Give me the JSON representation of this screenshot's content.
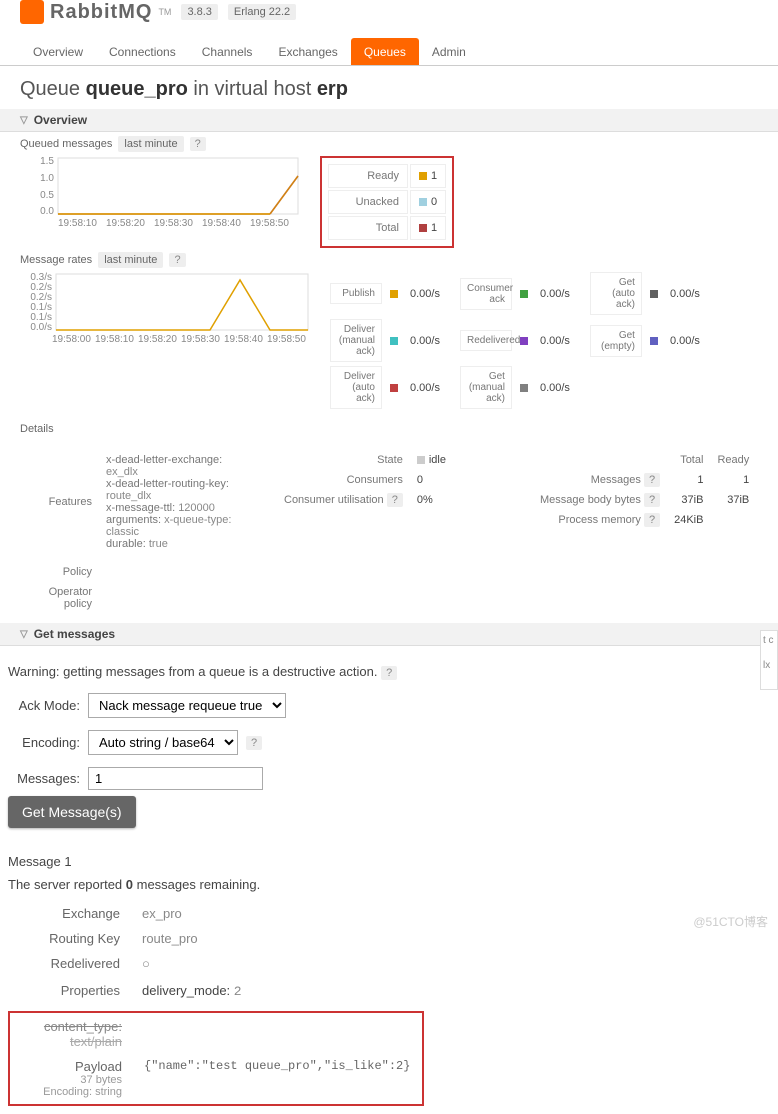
{
  "header": {
    "logo_text": "RabbitMQ",
    "tm": "TM",
    "version": "3.8.3",
    "erlang": "Erlang 22.2"
  },
  "tabs": [
    "Overview",
    "Connections",
    "Channels",
    "Exchanges",
    "Queues",
    "Admin"
  ],
  "active_tab": 4,
  "page_title_prefix": "Queue ",
  "queue_name": "queue_pro",
  "page_title_mid": " in virtual host ",
  "vhost": "erp",
  "overview_label": "Overview",
  "queued_msg_label": "Queued messages",
  "last_minute": "last minute",
  "help_q": "?",
  "queued_chart": {
    "y_ticks": [
      "1.5",
      "1.0",
      "0.5",
      "0.0"
    ],
    "x_ticks": [
      "19:58:10",
      "19:58:20",
      "19:58:30",
      "19:58:40",
      "19:58:50"
    ],
    "legend": [
      {
        "label": "Ready",
        "color": "#e0a000",
        "value": "1"
      },
      {
        "label": "Unacked",
        "color": "#a0d0e0",
        "value": "0"
      },
      {
        "label": "Total",
        "color": "#b04040",
        "value": "1"
      }
    ]
  },
  "rates_label": "Message rates",
  "rates_chart": {
    "y_ticks": [
      "0.3/s",
      "0.2/s",
      "0.2/s",
      "0.1/s",
      "0.1/s",
      "0.0/s"
    ],
    "x_ticks": [
      "19:58:00",
      "19:58:10",
      "19:58:20",
      "19:58:30",
      "19:58:40",
      "19:58:50"
    ]
  },
  "rates": [
    {
      "label": "Publish",
      "color": "#e0a000",
      "value": "0.00/s"
    },
    {
      "label": "Deliver (manual ack)",
      "color": "#40c0c0",
      "value": "0.00/s"
    },
    {
      "label": "Deliver (auto ack)",
      "color": "#c04040",
      "value": "0.00/s"
    },
    {
      "label": "Consumer ack",
      "color": "#40a040",
      "value": "0.00/s"
    },
    {
      "label": "Redelivered",
      "color": "#8040c0",
      "value": "0.00/s"
    },
    {
      "label": "Get (manual ack)",
      "color": "#808080",
      "value": "0.00/s"
    },
    {
      "label": "Get (auto ack)",
      "color": "#606060",
      "value": "0.00/s"
    },
    {
      "label": "Get (empty)",
      "color": "#6060c0",
      "value": "0.00/s"
    }
  ],
  "details_label": "Details",
  "features_label": "Features",
  "features": [
    {
      "k": "x-dead-letter-exchange:",
      "v": "ex_dlx"
    },
    {
      "k": "x-dead-letter-routing-key:",
      "v": "route_dlx"
    },
    {
      "k": "x-message-ttl:",
      "v": "120000"
    },
    {
      "k": "arguments:",
      "v": "x-queue-type: classic"
    },
    {
      "k": "durable:",
      "v": "true"
    }
  ],
  "policy_label": "Policy",
  "op_policy_label": "Operator policy",
  "state_label": "State",
  "state_value": "idle",
  "consumers_label": "Consumers",
  "consumers_value": "0",
  "util_label": "Consumer utilisation",
  "util_value": "0%",
  "totals": {
    "cols": [
      "Total",
      "Ready"
    ],
    "rows": [
      {
        "label": "Messages",
        "total": "1",
        "ready": "1"
      },
      {
        "label": "Message body bytes",
        "total": "37iB",
        "ready": "37iB"
      },
      {
        "label": "Process memory",
        "total": "24KiB",
        "ready": ""
      }
    ]
  },
  "get_msgs_label": "Get messages",
  "warning": "Warning: getting messages from a queue is a destructive action.",
  "form": {
    "ack_label": "Ack Mode:",
    "ack_value": "Nack message requeue true",
    "enc_label": "Encoding:",
    "enc_value": "Auto string / base64",
    "msgs_label": "Messages:",
    "msgs_value": "1",
    "button": "Get Message(s)"
  },
  "result": {
    "msg_header": "Message 1",
    "remaining_prefix": "The server reported ",
    "remaining_count": "0",
    "remaining_suffix": " messages remaining.",
    "rows": [
      {
        "k": "Exchange",
        "v": "ex_pro"
      },
      {
        "k": "Routing Key",
        "v": "route_pro"
      },
      {
        "k": "Redelivered",
        "v": "○"
      }
    ],
    "props_label": "Properties",
    "delivery_mode_k": "delivery_mode:",
    "delivery_mode_v": "2",
    "content_type_k": "content_type:",
    "content_type_v": "text/plain",
    "payload_label": "Payload",
    "payload_bytes": "37 bytes",
    "payload_enc": "Encoding: string",
    "payload_body": "{\"name\":\"test queue_pro\",\"is_like\":2}"
  },
  "right_strip": {
    "t1": "t c",
    "t2": "lx"
  },
  "watermark": "@51CTO博客"
}
